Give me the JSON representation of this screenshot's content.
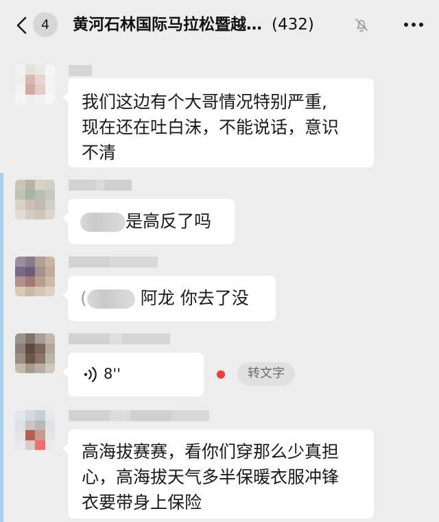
{
  "header": {
    "back_icon": "chevron-left-icon",
    "unread_count": "4",
    "title": "黄河石林国际马拉松暨越…",
    "member_count": "(432)",
    "mute_icon": "bell-slash-icon",
    "more_icon": "ellipsis-icon"
  },
  "messages": [
    {
      "type": "text",
      "lines": [
        "我们这边有个大哥情况特别严重,",
        "现在还在吐白沫，不能说话，意识",
        "不清"
      ]
    },
    {
      "type": "text",
      "text": "是高反了吗"
    },
    {
      "type": "text",
      "prefix": "(",
      "text": "阿龙 你去了没"
    },
    {
      "type": "voice",
      "icon": "voice-wave-icon",
      "duration": "8''",
      "unread_dot_color": "#f03c3c",
      "convert_label": "转文字"
    },
    {
      "type": "text",
      "lines": [
        "高海拔赛赛，看你们穿那么少真担",
        "心，高海拔天气多半保暖衣服冲锋",
        "衣要带身上保险"
      ]
    }
  ],
  "colors": {
    "background": "#ededed",
    "bubble": "#ffffff",
    "selection_edge": "#a9d0ea"
  }
}
